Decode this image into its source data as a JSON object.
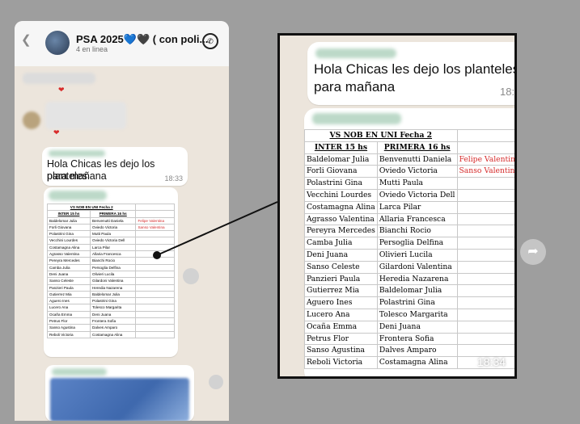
{
  "chat": {
    "name": "PSA 2025💙🖤 ( con poli...",
    "status": "4 en linea",
    "back_icon": "chevron-left-icon",
    "call_icon": "call-icon"
  },
  "message": {
    "text_line1": "Hola Chicas les dejo los planteles",
    "text_line2": "para mañana",
    "time": "18:33"
  },
  "image_message": {
    "time": "18:34",
    "table_title": "VS NOB EN UNI Fecha 2",
    "col1_header": "INTER 15 hs",
    "col2_header": "PRIMERA 16 hs",
    "rows": [
      [
        "Baldelomar Julia",
        "Benvenutti Daniela",
        "Felipe Valentina"
      ],
      [
        "Forli Giovana",
        "Oviedo Victoria",
        "Sanso Valentina"
      ],
      [
        "Polastrini Gina",
        "Mutti Paula",
        ""
      ],
      [
        "Vecchini Lourdes",
        "Oviedo Victoria Dell",
        ""
      ],
      [
        "Costamagna Alina",
        "Larca Pilar",
        ""
      ],
      [
        "Agrasso Valentina",
        "Allaria Francesca",
        ""
      ],
      [
        "Pereyra Mercedes",
        "Bianchi Rocio",
        ""
      ],
      [
        "Camba Julia",
        "Persoglia Delfina",
        ""
      ],
      [
        "Deni Juana",
        "Olivieri Lucila",
        ""
      ],
      [
        "Sanso Celeste",
        "Gilardoni Valentina",
        ""
      ],
      [
        "Panzieri Paula",
        "Heredia Nazarena",
        ""
      ],
      [
        "Gutierrez Mia",
        "Baldelomar Julia",
        ""
      ],
      [
        "Aguero Ines",
        "Polastrini Gina",
        ""
      ],
      [
        "Lucero Ana",
        "Tolesco Margarita",
        ""
      ],
      [
        "Ocaña Emma",
        "Deni Juana",
        ""
      ],
      [
        "Petrus Flor",
        "Frontera Sofia",
        ""
      ],
      [
        "Sanso Agustina",
        "Dalves Amparo",
        ""
      ],
      [
        "Reboli Victoria",
        "Costamagna Alina",
        ""
      ]
    ]
  },
  "colors": {
    "highlight": "#d52a2a",
    "background": "#9e9e9e"
  },
  "forward_icon": "forward-arrow-icon"
}
